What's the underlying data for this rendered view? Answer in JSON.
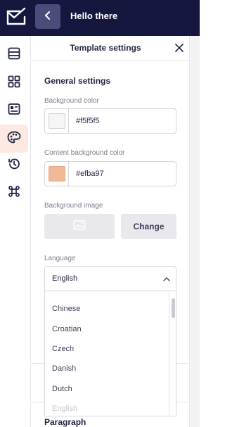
{
  "topbar": {
    "title": "Hello there",
    "logo_icon": "mail-check-icon",
    "back_icon": "chevron-left-icon"
  },
  "sidebar": {
    "items": [
      {
        "icon": "layers-icon",
        "active": false
      },
      {
        "icon": "grid-icon",
        "active": false
      },
      {
        "icon": "layout-icon",
        "active": false
      },
      {
        "icon": "palette-icon",
        "active": true
      },
      {
        "icon": "history-icon",
        "active": false
      },
      {
        "icon": "command-icon",
        "active": false
      }
    ]
  },
  "panel": {
    "title": "Template settings",
    "close_icon": "close-icon",
    "general": {
      "title": "General settings",
      "background_color": {
        "label": "Background color",
        "value": "#f5f5f5"
      },
      "content_background_color": {
        "label": "Content background color",
        "value": "#efba97"
      },
      "background_image": {
        "label": "Background image",
        "change_label": "Change",
        "placeholder_icon": "image-icon"
      },
      "language": {
        "label": "Language",
        "selected": "English",
        "options": [
          "Chinese",
          "Croatian",
          "Czech",
          "Danish",
          "Dutch",
          "English"
        ]
      }
    },
    "paragraph": {
      "title": "Paragraph"
    }
  },
  "colors": {
    "topbar_bg": "#16173f",
    "back_button_bg": "#4a4c7a",
    "active_sidebar_bg": "#fde9e2",
    "content_swatch": "#efba97",
    "background_swatch": "#f5f5f5"
  }
}
